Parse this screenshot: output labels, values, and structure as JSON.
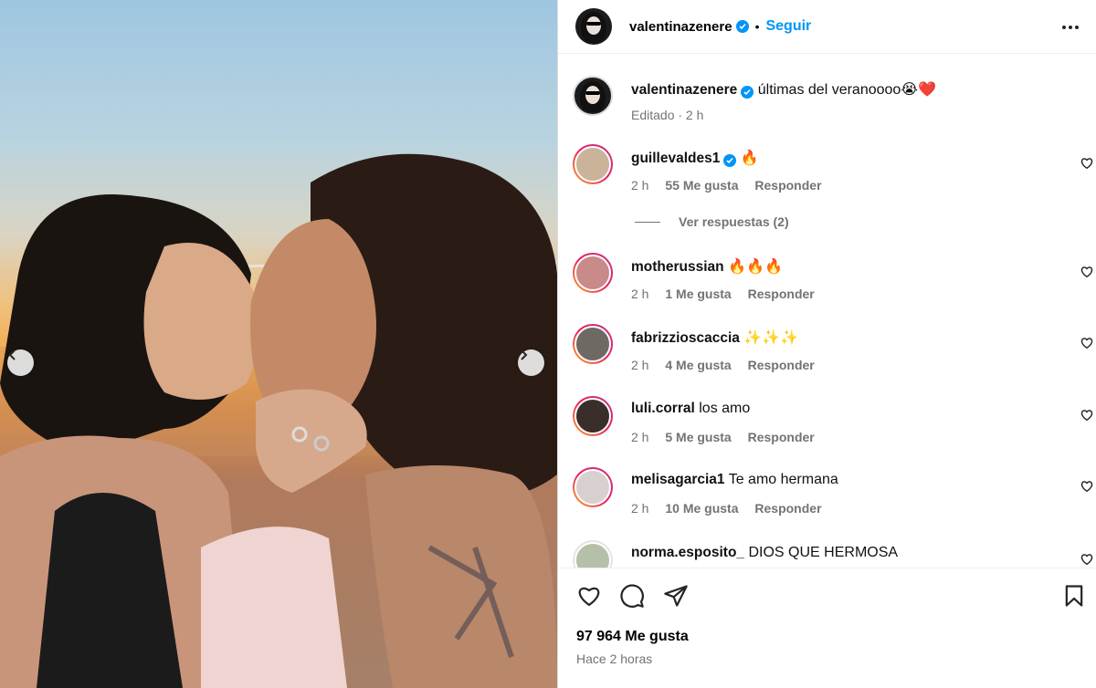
{
  "post": {
    "username": "valentinazenere",
    "follow_label": "Seguir",
    "dot": "•",
    "caption_text": "últimas del veranoooo😭❤️",
    "caption_meta": "Editado · 2 h",
    "likes": "97 964 Me gusta",
    "time_ago": "Hace 2 horas"
  },
  "comments": [
    {
      "user": "guillevaldes1",
      "verified": true,
      "text": "🔥",
      "time": "2 h",
      "likes": "55 Me gusta",
      "reply": "Responder"
    },
    {
      "user": "motherussian",
      "verified": false,
      "text": "🔥🔥🔥",
      "time": "2 h",
      "likes": "1 Me gusta",
      "reply": "Responder"
    },
    {
      "user": "fabrizzioscaccia",
      "verified": false,
      "text": "✨✨✨",
      "time": "2 h",
      "likes": "4 Me gusta",
      "reply": "Responder"
    },
    {
      "user": "luli.corral",
      "verified": false,
      "text": "los amo",
      "time": "2 h",
      "likes": "5 Me gusta",
      "reply": "Responder"
    },
    {
      "user": "melisagarcia1",
      "verified": false,
      "text": "Te amo hermana",
      "time": "2 h",
      "likes": "10 Me gusta",
      "reply": "Responder"
    },
    {
      "user": "norma.esposito_",
      "verified": false,
      "text": "DIOS QUE HERMOSA",
      "time": "",
      "likes": "",
      "reply": ""
    }
  ],
  "replies_label": "Ver respuestas (2)",
  "icons": [
    "chevron-left-icon",
    "chevron-right-icon",
    "more-icon",
    "verified-icon",
    "heart-icon",
    "comment-icon",
    "share-icon",
    "bookmark-icon"
  ],
  "colors": {
    "accent": "#0095f6",
    "muted": "#737373",
    "border": "#dbdbdb"
  }
}
